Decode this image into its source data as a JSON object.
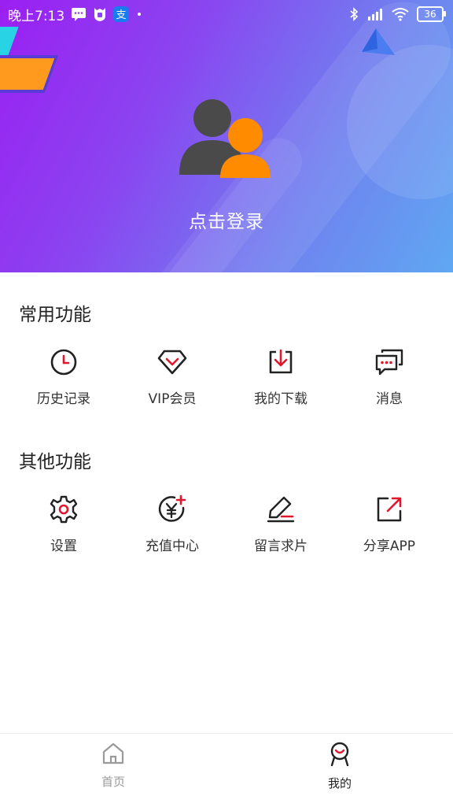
{
  "status_bar": {
    "time": "晚上7:13",
    "battery": "36",
    "icons": [
      "message-icon",
      "shield-icon",
      "alipay-icon",
      "dot-icon",
      "bluetooth-icon",
      "signal-icon",
      "wifi-icon",
      "battery-icon"
    ]
  },
  "header": {
    "login_label": "点击登录",
    "avatar_icon": "user-group-icon",
    "colors": {
      "gradient_start": "#9b1ff2",
      "gradient_end": "#5fa8f2"
    }
  },
  "sections": [
    {
      "title": "常用功能",
      "items": [
        {
          "label": "历史记录",
          "icon": "clock-icon"
        },
        {
          "label": "VIP会员",
          "icon": "diamond-icon"
        },
        {
          "label": "我的下载",
          "icon": "download-icon"
        },
        {
          "label": "消息",
          "icon": "chat-icon"
        }
      ]
    },
    {
      "title": "其他功能",
      "items": [
        {
          "label": "设置",
          "icon": "gear-icon"
        },
        {
          "label": "充值中心",
          "icon": "recharge-icon"
        },
        {
          "label": "留言求片",
          "icon": "edit-icon"
        },
        {
          "label": "分享APP",
          "icon": "share-icon"
        }
      ]
    }
  ],
  "bottom_nav": [
    {
      "label": "首页",
      "icon": "home-icon",
      "active": false
    },
    {
      "label": "我的",
      "icon": "profile-icon",
      "active": true
    }
  ],
  "colors": {
    "accent": "#e0182d",
    "icon_dark": "#222222"
  }
}
